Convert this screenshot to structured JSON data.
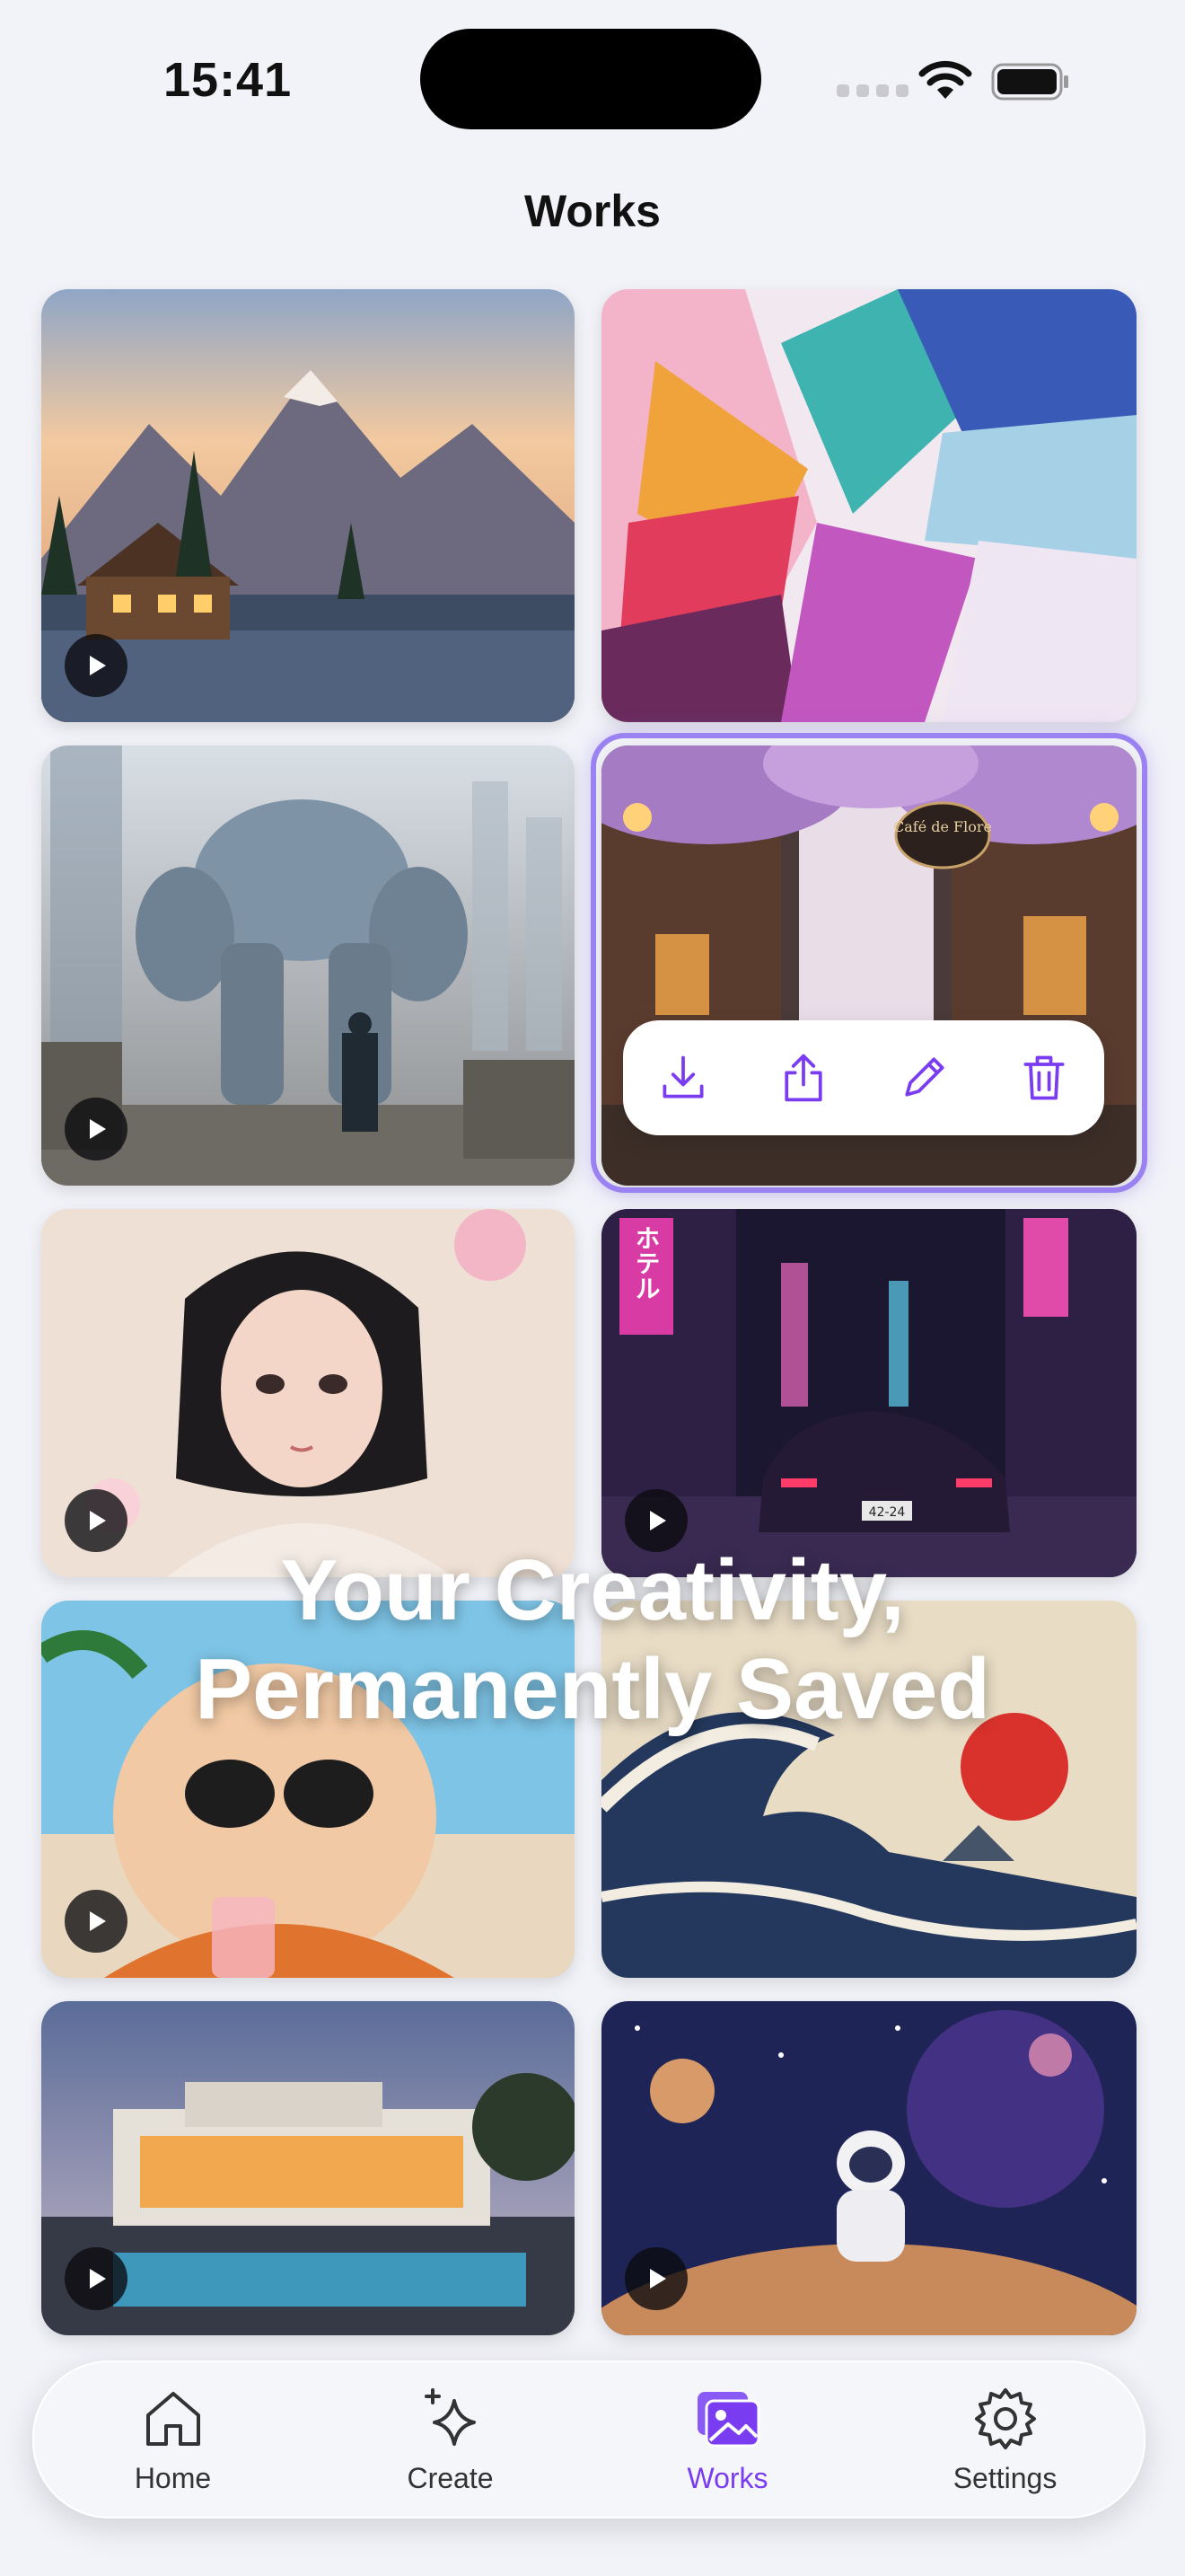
{
  "status_bar": {
    "time": "15:41"
  },
  "header": {
    "title": "Works"
  },
  "works": [
    {
      "name": "mountain-cabin-lake",
      "has_play": true
    },
    {
      "name": "abstract-paint-strokes",
      "has_play": false
    },
    {
      "name": "giant-mech-city",
      "has_play": true
    },
    {
      "name": "wisteria-cafe-street",
      "has_play": false,
      "selected": true
    },
    {
      "name": "anime-girl-blossoms",
      "has_play": true
    },
    {
      "name": "neon-tokyo-car",
      "has_play": true
    },
    {
      "name": "cat-sunglasses-beach",
      "has_play": true
    },
    {
      "name": "great-wave",
      "has_play": false
    },
    {
      "name": "modern-villa-pool",
      "has_play": true
    },
    {
      "name": "astronaut-moon",
      "has_play": true
    }
  ],
  "card_texts": {
    "cafe_sign": "Café de Flore",
    "neon_sign": "ホテル",
    "plate": "42-24"
  },
  "actions": [
    {
      "icon": "download-icon"
    },
    {
      "icon": "share-icon"
    },
    {
      "icon": "edit-icon"
    },
    {
      "icon": "trash-icon"
    }
  ],
  "overlay": {
    "line1": "Your Creativity,",
    "line2": "Permanently Saved"
  },
  "tabbar": {
    "items": [
      {
        "label": "Home",
        "icon": "home-icon",
        "active": false
      },
      {
        "label": "Create",
        "icon": "sparkle-icon",
        "active": false
      },
      {
        "label": "Works",
        "icon": "gallery-icon",
        "active": true
      },
      {
        "label": "Settings",
        "icon": "gear-icon",
        "active": false
      }
    ]
  },
  "colors": {
    "accent": "#7a3cf0",
    "background": "#f2f3f8"
  }
}
